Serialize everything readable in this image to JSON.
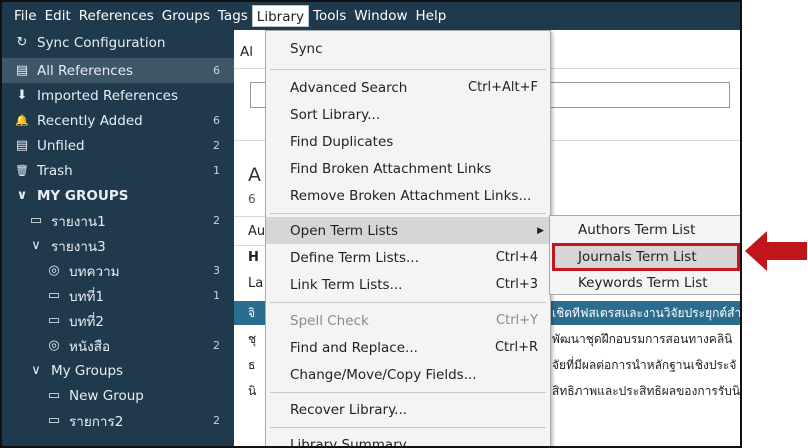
{
  "menubar": [
    "File",
    "Edit",
    "References",
    "Groups",
    "Tags",
    "Library",
    "Tools",
    "Window",
    "Help"
  ],
  "menubar_open": "Library",
  "sidebar": [
    {
      "label": "Sync Configuration",
      "icon": "sync-icon",
      "glyph": "↻",
      "count": ""
    },
    {
      "label": "All References",
      "icon": "references-icon",
      "glyph": "▤",
      "count": "6"
    },
    {
      "label": "Imported References",
      "icon": "import-icon",
      "glyph": "⬇",
      "count": ""
    },
    {
      "label": "Recently Added",
      "icon": "bell-icon",
      "glyph": "🔔",
      "count": "6"
    },
    {
      "label": "Unfiled",
      "icon": "unfiled-icon",
      "glyph": "▤",
      "count": "2"
    },
    {
      "label": "Trash",
      "icon": "trash-icon",
      "glyph": "🗑",
      "count": "1"
    },
    {
      "label": "MY GROUPS",
      "icon": "chevron-down-icon",
      "glyph": "∨",
      "count": ""
    },
    {
      "label": "รายงาน1",
      "icon": "group-icon",
      "glyph": "▭",
      "count": "2"
    },
    {
      "label": "รายงาน3",
      "icon": "chevron-down-icon",
      "glyph": "∨",
      "count": ""
    },
    {
      "label": "บทความ",
      "icon": "smart-group-icon",
      "glyph": "◎",
      "count": "3"
    },
    {
      "label": "บทที่1",
      "icon": "group-icon",
      "glyph": "▭",
      "count": "1"
    },
    {
      "label": "บทที่2",
      "icon": "group-icon",
      "glyph": "▭",
      "count": ""
    },
    {
      "label": "หนังสือ",
      "icon": "smart-group-icon",
      "glyph": "◎",
      "count": "2"
    },
    {
      "label": "My Groups",
      "icon": "chevron-down-icon",
      "glyph": "∨",
      "count": ""
    },
    {
      "label": "New Group",
      "icon": "group-icon",
      "glyph": "▭",
      "count": ""
    },
    {
      "label": "รายการ2",
      "icon": "group-icon",
      "glyph": "▭",
      "count": "2"
    }
  ],
  "main_fragments": {
    "all": "Al",
    "a_big": "A",
    "six": "6",
    "au": "Au",
    "h": "H",
    "la": "La",
    "row_sel_left": "จิ",
    "row_sel_right": "เชิดทีฟสเตรสและงานวิจัยประยุกต์สำ",
    "row2_left": "ชุ",
    "row2_right": "พัฒนาชุดฝึกอบรมการสอนทางคลินิ",
    "row3_left": "ธ",
    "row3_right": "จัยที่มีผลต่อการนำหลักฐานเชิงประจั",
    "row4_left": "นิ",
    "row4_right": "สิทธิภาพและประสิทธิผลของการรับนิสิ"
  },
  "menu": [
    {
      "label": "Sync",
      "shortcut": ""
    },
    {
      "label": "Advanced Search",
      "shortcut": "Ctrl+Alt+F"
    },
    {
      "label": "Sort Library...",
      "shortcut": ""
    },
    {
      "label": "Find Duplicates",
      "shortcut": ""
    },
    {
      "label": "Find Broken Attachment Links",
      "shortcut": ""
    },
    {
      "label": "Remove Broken Attachment Links...",
      "shortcut": ""
    },
    {
      "label": "Open Term Lists",
      "shortcut": ""
    },
    {
      "label": "Define Term Lists...",
      "shortcut": "Ctrl+4"
    },
    {
      "label": "Link Term Lists...",
      "shortcut": "Ctrl+3"
    },
    {
      "label": "Spell Check",
      "shortcut": "Ctrl+Y"
    },
    {
      "label": "Find and Replace...",
      "shortcut": "Ctrl+R"
    },
    {
      "label": "Change/Move/Copy Fields...",
      "shortcut": ""
    },
    {
      "label": "Recover Library...",
      "shortcut": ""
    },
    {
      "label": "Library Summary",
      "shortcut": ""
    }
  ],
  "submenu": [
    "Authors Term List",
    "Journals Term List",
    "Keywords Term List"
  ],
  "colors": {
    "sidebar_bg": "#1f3a4d",
    "highlight_border": "#c4161c",
    "selected_row": "#2b6d8f"
  }
}
